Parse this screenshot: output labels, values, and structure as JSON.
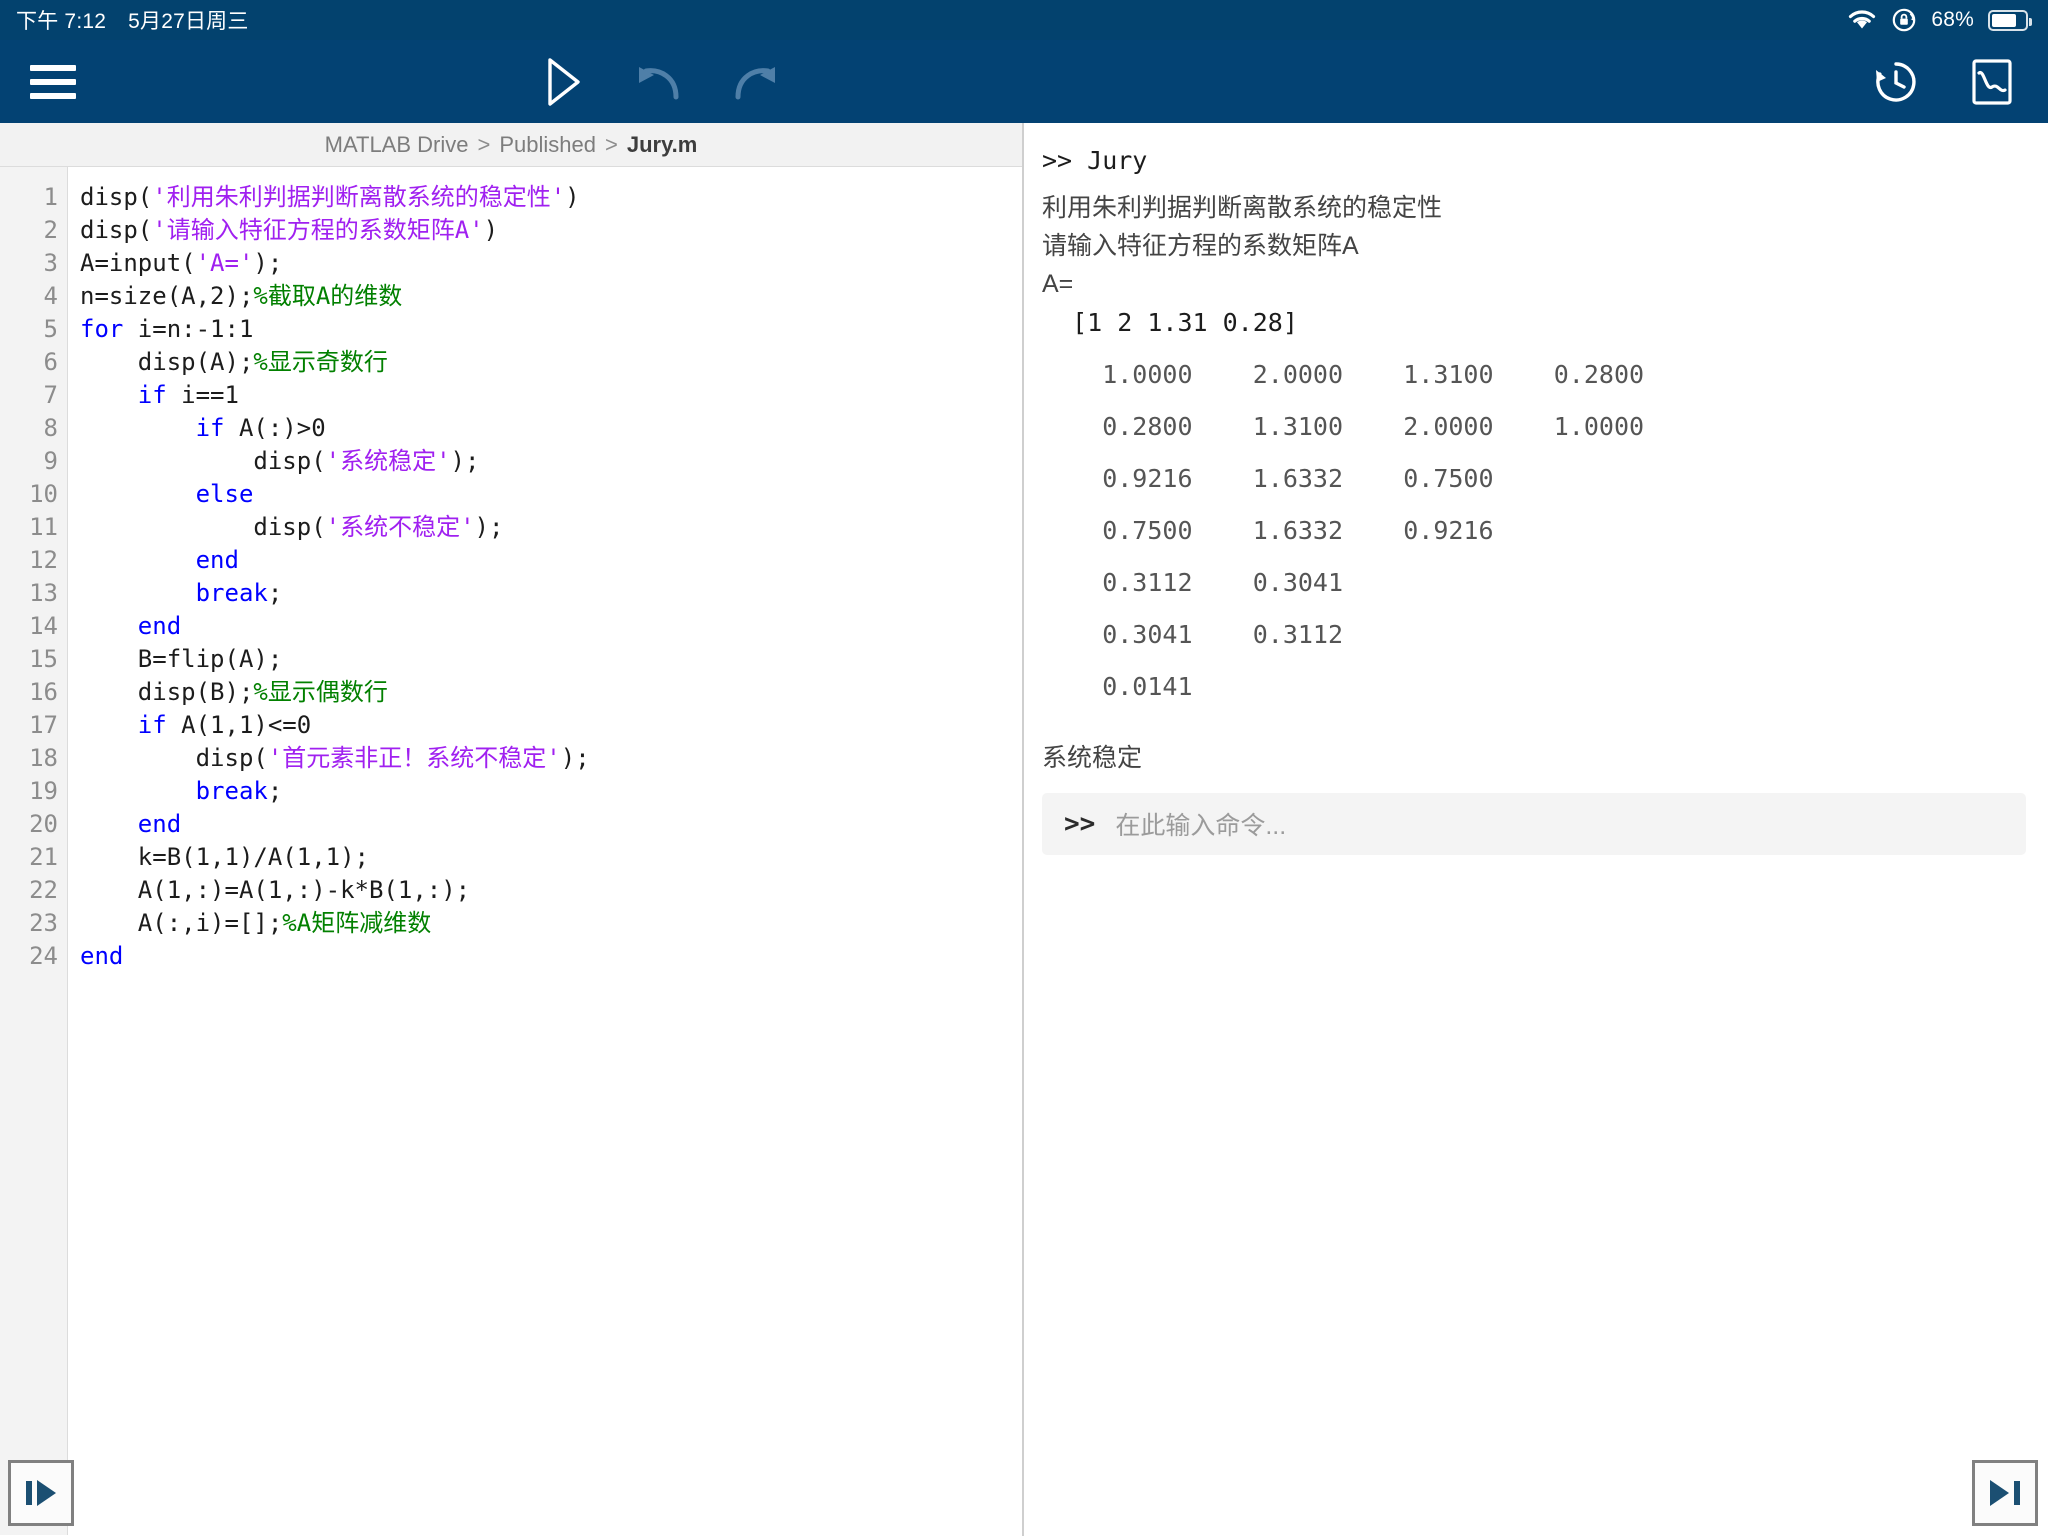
{
  "status_bar": {
    "time": "下午 7:12",
    "date": "5月27日周三",
    "battery_percent": "68%",
    "wifi_icon": "wifi-icon",
    "rotation_lock_icon": "rotation-lock-icon",
    "battery_icon": "battery-icon"
  },
  "toolbar": {
    "menu_icon": "hamburger-menu-icon",
    "run_icon": "run-play-icon",
    "undo_icon": "undo-arrow-icon",
    "redo_icon": "redo-arrow-icon",
    "history_icon": "command-history-icon",
    "figures_icon": "figures-plot-icon"
  },
  "breadcrumb": {
    "root": "MATLAB Drive",
    "separator": ">",
    "folder": "Published",
    "file": "Jury.m"
  },
  "editor": {
    "line_numbers": [
      "1",
      "2",
      "3",
      "4",
      "5",
      "6",
      "7",
      "8",
      "9",
      "10",
      "11",
      "12",
      "13",
      "14",
      "15",
      "16",
      "17",
      "18",
      "19",
      "20",
      "21",
      "22",
      "23",
      "24"
    ],
    "lines": [
      {
        "n": 1,
        "segments": [
          {
            "t": "disp(",
            "c": "plain"
          },
          {
            "t": "'利用朱利判据判断离散系统的稳定性'",
            "c": "str"
          },
          {
            "t": ")",
            "c": "plain"
          }
        ]
      },
      {
        "n": 2,
        "segments": [
          {
            "t": "disp(",
            "c": "plain"
          },
          {
            "t": "'请输入特征方程的系数矩阵A'",
            "c": "str"
          },
          {
            "t": ")",
            "c": "plain"
          }
        ]
      },
      {
        "n": 3,
        "segments": [
          {
            "t": "A=input(",
            "c": "plain"
          },
          {
            "t": "'A='",
            "c": "str"
          },
          {
            "t": ");",
            "c": "plain"
          }
        ]
      },
      {
        "n": 4,
        "segments": [
          {
            "t": "n=size(A,2);",
            "c": "plain"
          },
          {
            "t": "%截取A的维数",
            "c": "cmt"
          }
        ]
      },
      {
        "n": 5,
        "segments": [
          {
            "t": "for",
            "c": "kw"
          },
          {
            "t": " i=n:-1:1",
            "c": "plain"
          }
        ]
      },
      {
        "n": 6,
        "segments": [
          {
            "t": "    disp(A);",
            "c": "plain"
          },
          {
            "t": "%显示奇数行",
            "c": "cmt"
          }
        ]
      },
      {
        "n": 7,
        "segments": [
          {
            "t": "    ",
            "c": "plain"
          },
          {
            "t": "if",
            "c": "kw"
          },
          {
            "t": " i==1",
            "c": "plain"
          }
        ]
      },
      {
        "n": 8,
        "segments": [
          {
            "t": "        ",
            "c": "plain"
          },
          {
            "t": "if",
            "c": "kw"
          },
          {
            "t": " A(:)>0",
            "c": "plain"
          }
        ]
      },
      {
        "n": 9,
        "segments": [
          {
            "t": "            disp(",
            "c": "plain"
          },
          {
            "t": "'系统稳定'",
            "c": "str"
          },
          {
            "t": ");",
            "c": "plain"
          }
        ]
      },
      {
        "n": 10,
        "segments": [
          {
            "t": "        ",
            "c": "plain"
          },
          {
            "t": "else",
            "c": "kw"
          }
        ]
      },
      {
        "n": 11,
        "segments": [
          {
            "t": "            disp(",
            "c": "plain"
          },
          {
            "t": "'系统不稳定'",
            "c": "str"
          },
          {
            "t": ");",
            "c": "plain"
          }
        ]
      },
      {
        "n": 12,
        "segments": [
          {
            "t": "        ",
            "c": "plain"
          },
          {
            "t": "end",
            "c": "kw"
          }
        ]
      },
      {
        "n": 13,
        "segments": [
          {
            "t": "        ",
            "c": "plain"
          },
          {
            "t": "break",
            "c": "kw"
          },
          {
            "t": ";",
            "c": "plain"
          }
        ]
      },
      {
        "n": 14,
        "segments": [
          {
            "t": "    ",
            "c": "plain"
          },
          {
            "t": "end",
            "c": "kw"
          }
        ]
      },
      {
        "n": 15,
        "segments": [
          {
            "t": "    B=flip(A);",
            "c": "plain"
          }
        ]
      },
      {
        "n": 16,
        "segments": [
          {
            "t": "    disp(B);",
            "c": "plain"
          },
          {
            "t": "%显示偶数行",
            "c": "cmt"
          }
        ]
      },
      {
        "n": 17,
        "segments": [
          {
            "t": "    ",
            "c": "plain"
          },
          {
            "t": "if",
            "c": "kw"
          },
          {
            "t": " A(1,1)<=0",
            "c": "plain"
          }
        ]
      },
      {
        "n": 18,
        "segments": [
          {
            "t": "        disp(",
            "c": "plain"
          },
          {
            "t": "'首元素非正！系统不稳定'",
            "c": "str"
          },
          {
            "t": ");",
            "c": "plain"
          }
        ]
      },
      {
        "n": 19,
        "segments": [
          {
            "t": "        ",
            "c": "plain"
          },
          {
            "t": "break",
            "c": "kw"
          },
          {
            "t": ";",
            "c": "plain"
          }
        ]
      },
      {
        "n": 20,
        "segments": [
          {
            "t": "    ",
            "c": "plain"
          },
          {
            "t": "end",
            "c": "kw"
          }
        ]
      },
      {
        "n": 21,
        "segments": [
          {
            "t": "    k=B(1,1)/A(1,1);",
            "c": "plain"
          }
        ]
      },
      {
        "n": 22,
        "segments": [
          {
            "t": "    A(1,:)=A(1,:)-k*B(1,:);",
            "c": "plain"
          }
        ]
      },
      {
        "n": 23,
        "segments": [
          {
            "t": "    A(:,i)=[];",
            "c": "plain"
          },
          {
            "t": "%A矩阵减维数",
            "c": "cmt"
          }
        ]
      },
      {
        "n": 24,
        "segments": [
          {
            "t": "end",
            "c": "kw"
          }
        ]
      }
    ]
  },
  "console": {
    "command_echo": ">> Jury",
    "message_1": "利用朱利判据判断离散系统的稳定性",
    "message_2": "请输入特征方程的系数矩阵A",
    "prompt_label": "A=",
    "user_input": "  [1 2 1.31 0.28]",
    "matrix_rows": [
      "    1.0000    2.0000    1.3100    0.2800",
      "    0.2800    1.3100    2.0000    1.0000",
      "    0.9216    1.6332    0.7500",
      "    0.7500    1.6332    0.9216",
      "    0.3112    0.3041",
      "    0.3041    0.3112",
      "    0.0141"
    ],
    "result": "系统稳定",
    "input_prompt_symbol": ">>",
    "input_placeholder": "在此输入命令..."
  },
  "footer": {
    "left_button_icon": "step-into-right-icon",
    "right_button_icon": "step-to-end-icon"
  },
  "colors": {
    "toolbar_blue": "#034273",
    "status_blue": "#03426e",
    "keyword": "#0000ff",
    "string": "#a020f0",
    "comment": "#028000",
    "icon_blue": "#1b4f72"
  }
}
